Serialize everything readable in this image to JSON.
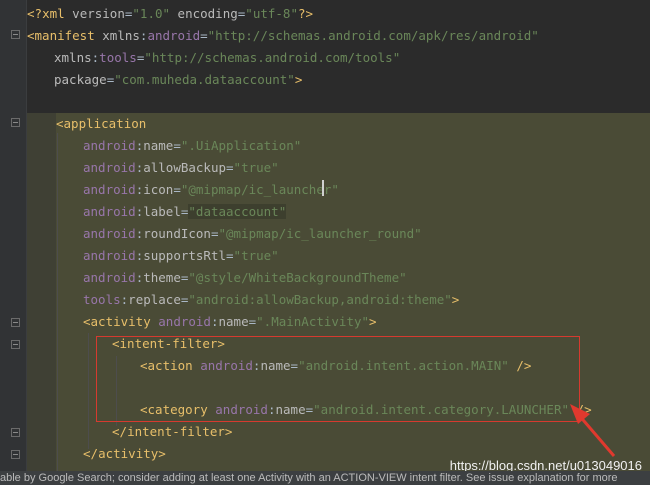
{
  "colors": {
    "background": "#2b2b2b",
    "tag": "#e8bf6a",
    "namespace": "#9876aa",
    "attribute": "#bababa",
    "string": "#6a8759",
    "highlight_box": "#d63a2f",
    "arrow": "#e0392e"
  },
  "code": {
    "line1": {
      "open": "<?",
      "tag": "xml",
      "a1": " version",
      "eq1": "=",
      "v1": "\"1.0\"",
      "a2": " encoding",
      "eq2": "=",
      "v2": "\"utf-8\"",
      "close": "?>"
    },
    "line2": {
      "open": "<",
      "tag": "manifest",
      "a1": " xmlns",
      "colon": ":",
      "ns1": "android",
      "eq": "=",
      "v1": "\"http://schemas.android.com/apk/res/android\""
    },
    "line3": {
      "attr": "xmlns",
      "colon": ":",
      "ns": "tools",
      "eq": "=",
      "v": "\"http://schemas.android.com/tools\""
    },
    "line4": {
      "attr": "package",
      "eq": "=",
      "v": "\"com.muheda.dataaccount\"",
      "close": ">"
    },
    "application": {
      "open": "<",
      "tag": "application"
    },
    "app_attrs": [
      {
        "ns": "android",
        "attr": "name",
        "value": "\".UiApplication\""
      },
      {
        "ns": "android",
        "attr": "allowBackup",
        "value": "\"true\""
      },
      {
        "ns": "android",
        "attr": "icon",
        "value": "\"@mipmap/ic_launcher\""
      },
      {
        "ns": "android",
        "attr": "label",
        "value": "\"dataaccount\""
      },
      {
        "ns": "android",
        "attr": "roundIcon",
        "value": "\"@mipmap/ic_launcher_round\""
      },
      {
        "ns": "android",
        "attr": "supportsRtl",
        "value": "\"true\""
      },
      {
        "ns": "android",
        "attr": "theme",
        "value": "\"@style/WhiteBackgroundTheme\""
      },
      {
        "ns": "tools",
        "attr": "replace",
        "value": "\"android:allowBackup,android:theme\"",
        "close": ">"
      }
    ],
    "activity": {
      "open": "<",
      "tag": "activity",
      "ns": " android",
      "attr": "name",
      "value": "\".MainActivity\"",
      "close": ">"
    },
    "intent_filter_open": {
      "open": "<",
      "tag": "intent-filter",
      "close": ">"
    },
    "action": {
      "open": "<",
      "tag": "action",
      "ns": " android",
      "attr": "name",
      "value": "\"android.intent.action.MAIN\"",
      "close": " />"
    },
    "category": {
      "open": "<",
      "tag": "category",
      "ns": " android",
      "attr": "name",
      "value": "\"android.intent.category.LAUNCHER\"",
      "close": " />"
    },
    "intent_filter_close": {
      "open": "</",
      "tag": "intent-filter",
      "close": ">"
    },
    "activity_close": {
      "open": "</",
      "tag": "activity",
      "close": ">"
    }
  },
  "watermark": "https://blog.csdn.net/u013049016",
  "status": "able by Google Search; consider adding at least one Activity with an ACTION-VIEW intent filter. See issue explanation for more"
}
